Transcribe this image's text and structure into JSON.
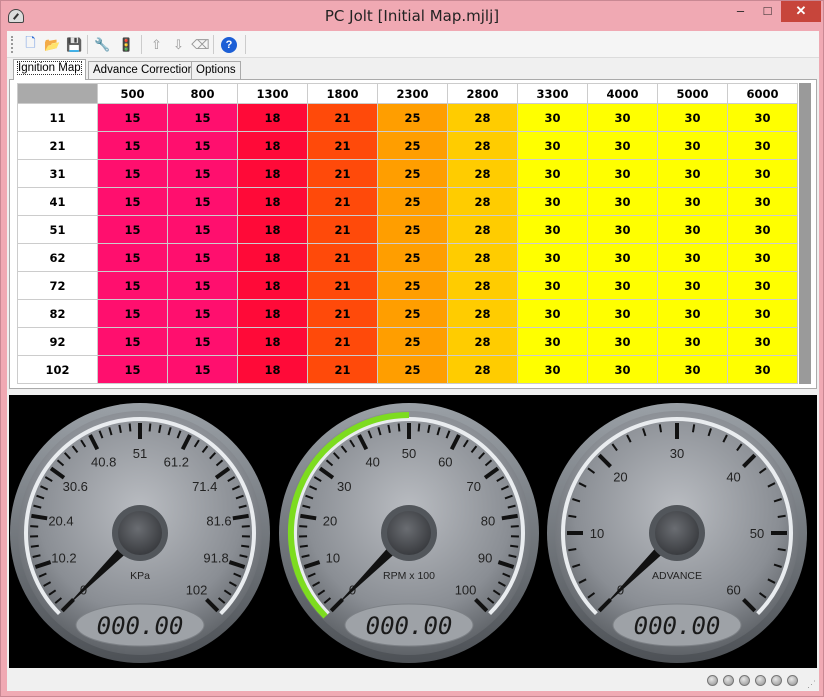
{
  "window": {
    "title": "PC Jolt [Initial Map.mjlj]",
    "controls": [
      "–",
      "□",
      "✕"
    ]
  },
  "toolbar": {
    "buttons": [
      {
        "name": "new-file-icon",
        "glyph": "🗋"
      },
      {
        "name": "open-folder-icon",
        "glyph": "📂"
      },
      {
        "name": "save-icon",
        "glyph": "💾"
      },
      {
        "name": "wrench-icon",
        "glyph": "🔧"
      },
      {
        "name": "traffic-light-icon",
        "glyph": "🚦"
      },
      {
        "name": "upload-icon",
        "glyph": "⇧"
      },
      {
        "name": "download-icon",
        "glyph": "⇩"
      },
      {
        "name": "eraser-icon",
        "glyph": "⌫"
      },
      {
        "name": "help-icon",
        "glyph": "?"
      }
    ]
  },
  "tabs": [
    {
      "label": "Ignition Map",
      "active": true
    },
    {
      "label": "Advance Correction",
      "active": false
    },
    {
      "label": "Options",
      "active": false
    }
  ],
  "ignition_map": {
    "rpm_columns": [
      "500",
      "800",
      "1300",
      "1800",
      "2300",
      "2800",
      "3300",
      "4000",
      "5000",
      "6000"
    ],
    "kpa_rows": [
      "11",
      "21",
      "31",
      "41",
      "51",
      "62",
      "72",
      "82",
      "92",
      "102"
    ],
    "values": [
      [
        "15",
        "15",
        "18",
        "21",
        "25",
        "28",
        "30",
        "30",
        "30",
        "30"
      ],
      [
        "15",
        "15",
        "18",
        "21",
        "25",
        "28",
        "30",
        "30",
        "30",
        "30"
      ],
      [
        "15",
        "15",
        "18",
        "21",
        "25",
        "28",
        "30",
        "30",
        "30",
        "30"
      ],
      [
        "15",
        "15",
        "18",
        "21",
        "25",
        "28",
        "30",
        "30",
        "30",
        "30"
      ],
      [
        "15",
        "15",
        "18",
        "21",
        "25",
        "28",
        "30",
        "30",
        "30",
        "30"
      ],
      [
        "15",
        "15",
        "18",
        "21",
        "25",
        "28",
        "30",
        "30",
        "30",
        "30"
      ],
      [
        "15",
        "15",
        "18",
        "21",
        "25",
        "28",
        "30",
        "30",
        "30",
        "30"
      ],
      [
        "15",
        "15",
        "18",
        "21",
        "25",
        "28",
        "30",
        "30",
        "30",
        "30"
      ],
      [
        "15",
        "15",
        "18",
        "21",
        "25",
        "28",
        "30",
        "30",
        "30",
        "30"
      ],
      [
        "15",
        "15",
        "18",
        "21",
        "25",
        "28",
        "30",
        "30",
        "30",
        "30"
      ]
    ],
    "cell_colors": {
      "15": "#ff0f6e",
      "18": "#ff0a38",
      "21": "#ff4a0a",
      "25": "#ff9e00",
      "28": "#ffcc00",
      "30": "#ffff00"
    }
  },
  "gauges": [
    {
      "name": "kpa-gauge",
      "unit": "KPa",
      "ticks": [
        "0",
        "10.2",
        "20.4",
        "30.6",
        "40.8",
        "51",
        "61.2",
        "71.4",
        "81.6",
        "91.8",
        "102"
      ],
      "readout": "000.00",
      "value": 0,
      "arc": 0
    },
    {
      "name": "rpm-gauge",
      "unit": "RPM x 100",
      "ticks": [
        "0",
        "10",
        "20",
        "30",
        "40",
        "50",
        "60",
        "70",
        "80",
        "90",
        "100"
      ],
      "readout": "000.00",
      "value": 0,
      "arc": 50
    },
    {
      "name": "advance-gauge",
      "unit": "ADVANCE",
      "ticks": [
        "0",
        "10",
        "20",
        "30",
        "40",
        "50",
        "60"
      ],
      "readout": "000.00",
      "value": 0,
      "arc": 0
    }
  ],
  "status": {
    "led_count": 6,
    "led_color": "#b4b4b4"
  }
}
